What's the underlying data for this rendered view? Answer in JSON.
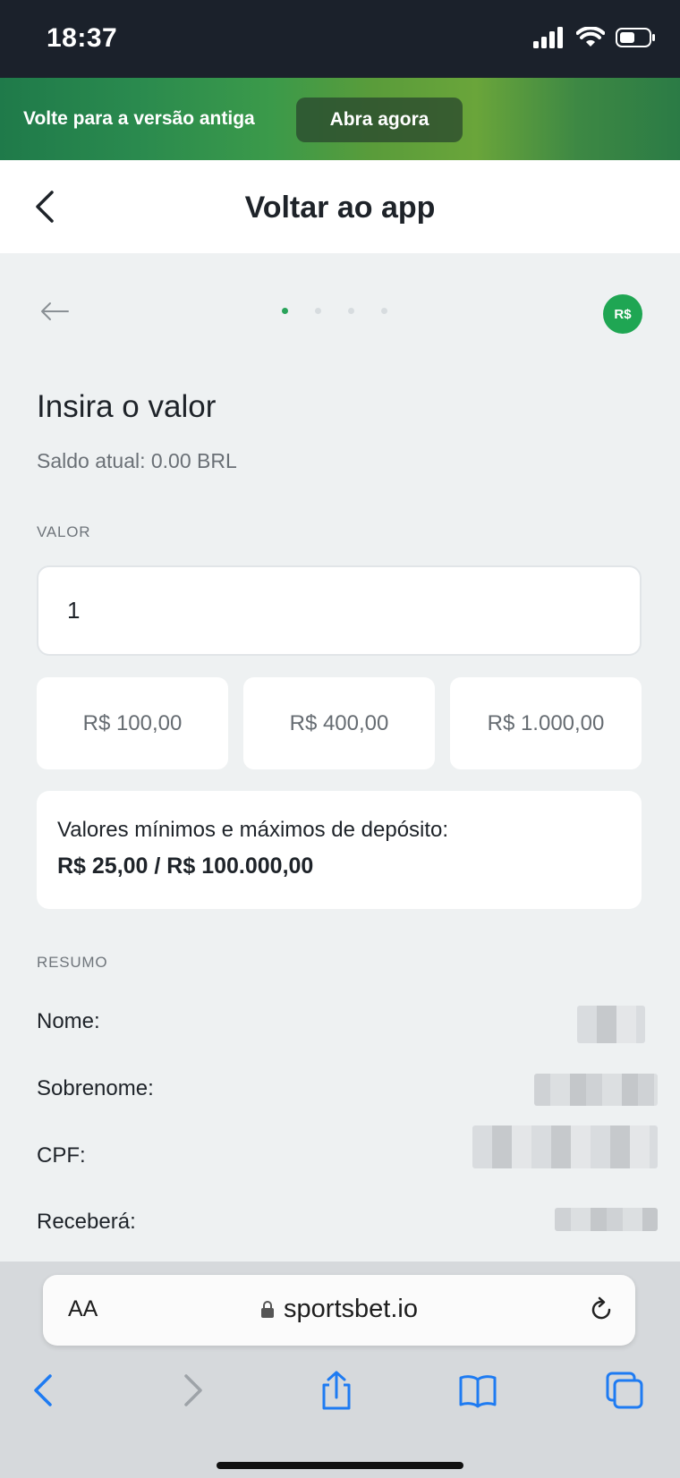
{
  "status_bar": {
    "time": "18:37"
  },
  "banner": {
    "text": "Volte para a versão antiga",
    "button": "Abra agora"
  },
  "header": {
    "title": "Voltar ao app"
  },
  "stepper": {
    "total_steps": 4,
    "current_step": 1,
    "currency_badge": "R$"
  },
  "deposit": {
    "title": "Insira o valor",
    "balance": "Saldo atual: 0.00 BRL",
    "amount_label": "VALOR",
    "amount_value": "1",
    "presets": [
      "R$ 100,00",
      "R$ 400,00",
      "R$ 1.000,00"
    ],
    "limits_label": "Valores mínimos e máximos de depósito:",
    "limits_value": "R$ 25,00 / R$ 100.000,00"
  },
  "summary": {
    "title": "RESUMO",
    "rows": [
      {
        "label": "Nome:"
      },
      {
        "label": "Sobrenome:"
      },
      {
        "label": "CPF:"
      },
      {
        "label": "Receberá:"
      }
    ]
  },
  "browser": {
    "aa": "AA",
    "url": "sportsbet.io"
  },
  "colors": {
    "accent": "#1fa653",
    "link_blue": "#1e7bf2",
    "status_bg": "#1b212b"
  }
}
